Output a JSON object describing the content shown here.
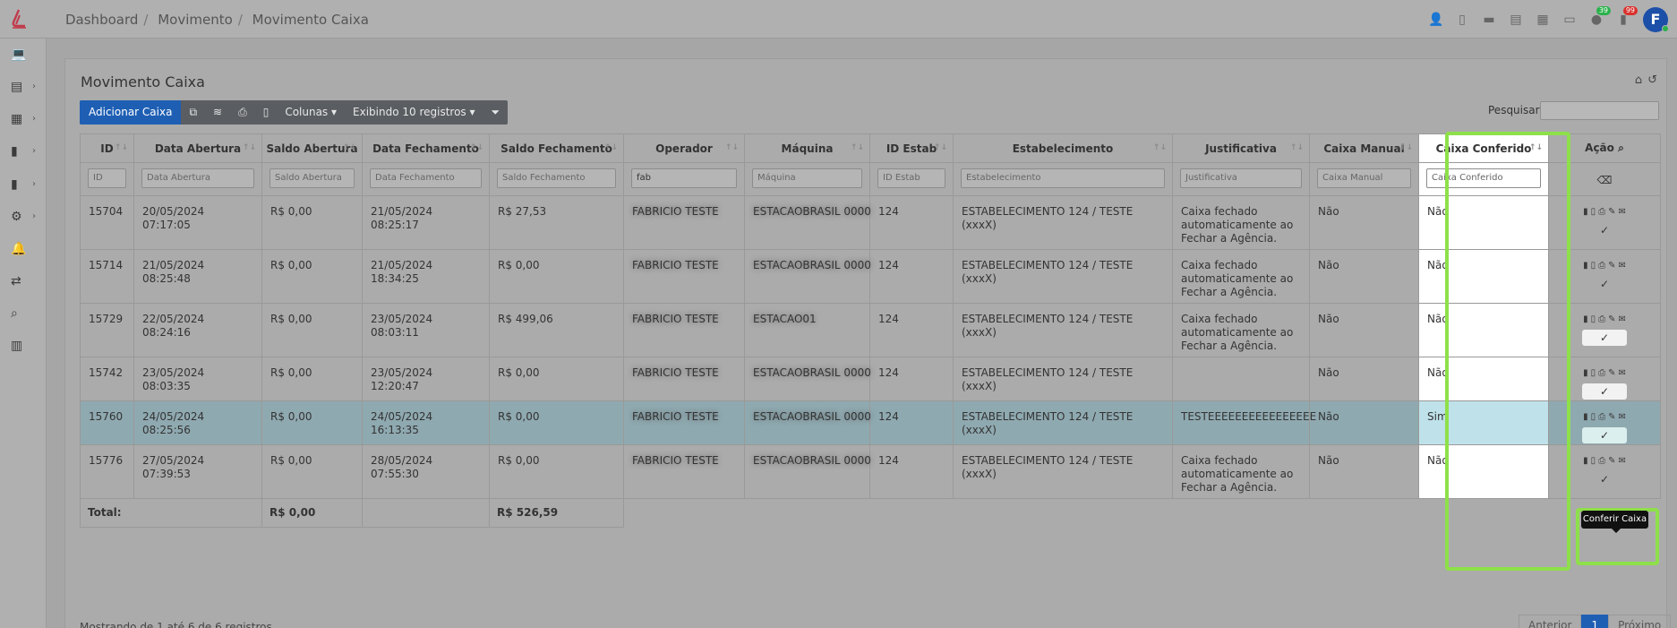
{
  "breadcrumb": [
    "Dashboard",
    "Movimento",
    "Movimento Caixa"
  ],
  "top_icons": [
    "user-cog-icon",
    "mobile-icon",
    "card-icon",
    "cash-register-icon",
    "newspaper-icon",
    "desktop-icon",
    "notification-icon",
    "bell-document-icon"
  ],
  "badges": {
    "green": "39",
    "red": "99"
  },
  "user_initial": "F",
  "colors": {
    "primary": "#1e5fb4",
    "highlight": "#8ee04a",
    "badge_green": "#2bb24c",
    "badge_red": "#d9302c"
  },
  "sidebar": [
    {
      "icon": "laptop-icon",
      "has_chevron": false
    },
    {
      "icon": "table-icon",
      "has_chevron": true
    },
    {
      "icon": "grid-icon",
      "has_chevron": true
    },
    {
      "icon": "file-icon",
      "has_chevron": true
    },
    {
      "icon": "file-alt-icon",
      "has_chevron": true
    },
    {
      "icon": "gears-icon",
      "has_chevron": true
    },
    {
      "icon": "bell-icon",
      "has_chevron": false
    },
    {
      "icon": "sync-icon",
      "has_chevron": false
    },
    {
      "icon": "search-icon",
      "has_chevron": false
    },
    {
      "icon": "columns-icon",
      "has_chevron": false
    }
  ],
  "page": {
    "title": "Movimento Caixa",
    "add_button": "Adicionar Caixa",
    "columns_button": "Colunas",
    "showing_button": "Exibindo 10 registros",
    "search_label": "Pesquisar"
  },
  "table": {
    "headers": [
      "ID",
      "Data Abertura",
      "Saldo Abertura",
      "Data Fechamento",
      "Saldo Fechamento",
      "Operador",
      "Máquina",
      "ID Estab",
      "Estabelecimento",
      "Justificativa",
      "Caixa Manual",
      "Caixa Conferido",
      "Ação"
    ],
    "filters": [
      "ID",
      "Data Abertura",
      "Saldo Abertura",
      "Data Fechamento",
      "Saldo Fechamento",
      "fab",
      "Máquina",
      "ID Estab",
      "Estabelecimento",
      "Justificativa",
      "Caixa Manual",
      "Caixa Conferido"
    ],
    "rows": [
      {
        "id": "15704",
        "abertura": "20/05/2024 07:17:05",
        "saldo_ab": "R$ 0,00",
        "fechamento": "21/05/2024 08:25:17",
        "saldo_fe": "R$ 27,53",
        "operador": "FABRICIO TESTE",
        "maquina": "ESTACAOBRASIL 0000",
        "id_estab": "124",
        "estab": "ESTABELECIMENTO 124 / TESTE (xxxX)",
        "just": "Caixa fechado automaticamente ao Fechar a Agência.",
        "manual": "Não",
        "conferido": "Não"
      },
      {
        "id": "15714",
        "abertura": "21/05/2024 08:25:48",
        "saldo_ab": "R$ 0,00",
        "fechamento": "21/05/2024 18:34:25",
        "saldo_fe": "R$ 0,00",
        "operador": "FABRICIO TESTE",
        "maquina": "ESTACAOBRASIL 0000",
        "id_estab": "124",
        "estab": "ESTABELECIMENTO 124 / TESTE (xxxX)",
        "just": "Caixa fechado automaticamente ao Fechar a Agência.",
        "manual": "Não",
        "conferido": "Não"
      },
      {
        "id": "15729",
        "abertura": "22/05/2024 08:24:16",
        "saldo_ab": "R$ 0,00",
        "fechamento": "23/05/2024 08:03:11",
        "saldo_fe": "R$ 499,06",
        "operador": "FABRICIO TESTE",
        "maquina": "ESTACAO01",
        "id_estab": "124",
        "estab": "ESTABELECIMENTO 124 / TESTE (xxxX)",
        "just": "Caixa fechado automaticamente ao Fechar a Agência.",
        "manual": "Não",
        "conferido": "Não"
      },
      {
        "id": "15742",
        "abertura": "23/05/2024 08:03:35",
        "saldo_ab": "R$ 0,00",
        "fechamento": "23/05/2024 12:20:47",
        "saldo_fe": "R$ 0,00",
        "operador": "FABRICIO TESTE",
        "maquina": "ESTACAOBRASIL 0000",
        "id_estab": "124",
        "estab": "ESTABELECIMENTO 124 / TESTE (xxxX)",
        "just": "",
        "manual": "Não",
        "conferido": "Não"
      },
      {
        "id": "15760",
        "abertura": "24/05/2024 08:25:56",
        "saldo_ab": "R$ 0,00",
        "fechamento": "24/05/2024 16:13:35",
        "saldo_fe": "R$ 0,00",
        "operador": "FABRICIO TESTE",
        "maquina": "ESTACAOBRASIL 0000",
        "id_estab": "124",
        "estab": "ESTABELECIMENTO 124 / TESTE (xxxX)",
        "just": "TESTEEEEEEEEEEEEEEEE",
        "manual": "Não",
        "conferido": "Sim"
      },
      {
        "id": "15776",
        "abertura": "27/05/2024 07:39:53",
        "saldo_ab": "R$ 0,00",
        "fechamento": "28/05/2024 07:55:30",
        "saldo_fe": "R$ 0,00",
        "operador": "FABRICIO TESTE",
        "maquina": "ESTACAOBRASIL 0000",
        "id_estab": "124",
        "estab": "ESTABELECIMENTO 124 / TESTE (xxxX)",
        "just": "Caixa fechado automaticamente ao Fechar a Agência.",
        "manual": "Não",
        "conferido": "Não"
      }
    ],
    "total_label": "Total:",
    "total_saldo_ab": "R$ 0,00",
    "total_saldo_fe": "R$ 526,59"
  },
  "tooltip": "Conferir Caixa",
  "footer": {
    "info": "Mostrando de 1 até 6 de 6 registros",
    "prev": "Anterior",
    "page": "1",
    "next": "Próximo"
  }
}
